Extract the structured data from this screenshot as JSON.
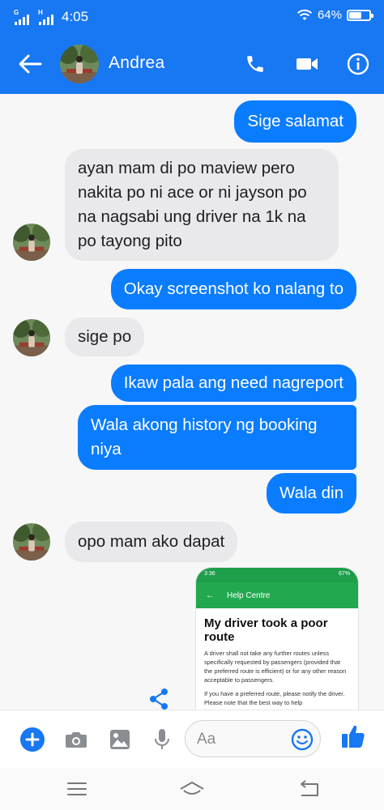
{
  "status_bar": {
    "sim1_label": "G",
    "sim2_label": "H",
    "time": "4:05",
    "battery": "64%",
    "battery_level": 0.64,
    "icons": [
      "signal-icon",
      "wifi-icon",
      "battery-icon"
    ]
  },
  "header": {
    "contact_name": "Andrea",
    "icons": [
      "back-arrow-icon",
      "phone-icon",
      "video-camera-icon",
      "info-icon"
    ],
    "color": "#1877f2"
  },
  "messages": [
    {
      "direction": "out",
      "text": "Sige salamat"
    },
    {
      "direction": "in",
      "lines": [
        "ayan mam di po maview pero",
        "nakita po ni ace or ni jayson po",
        "na nagsabi ung driver na 1k na",
        "po tayong pito"
      ]
    },
    {
      "direction": "out",
      "text": "Okay screenshot ko nalang to"
    },
    {
      "direction": "in",
      "text": "sige po"
    },
    {
      "direction": "out",
      "text": "Ikaw pala ang need nagreport"
    },
    {
      "direction": "out",
      "lines": [
        "Wala akong history ng booking",
        "niya"
      ]
    },
    {
      "direction": "out",
      "text": "Wala din"
    },
    {
      "direction": "in",
      "text": "opo mam ako dapat"
    }
  ],
  "image_message": {
    "status_time": "3:36",
    "status_battery": "67%",
    "app_bar_title": "Help Centre",
    "title": "My driver took a poor route",
    "body": [
      "A driver shall not take any further routes unless specifically requested by passengers (provided that the preferred route is efficient) or for any other reason acceptable to passengers.",
      "If you have a preferred route, please notify the driver. Please note that the best way to help"
    ]
  },
  "composer": {
    "placeholder": "Aa",
    "icons": [
      "plus-icon",
      "camera-icon",
      "gallery-icon",
      "microphone-icon",
      "emoji-icon",
      "thumbs-up-icon"
    ]
  },
  "colors": {
    "accent": "#1877f2",
    "outgoing_bubble": "#0a7cff",
    "incoming_bubble": "#e9e9eb"
  }
}
